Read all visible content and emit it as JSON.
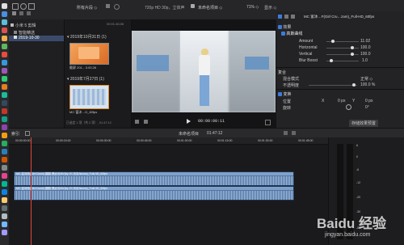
{
  "toolbar": {
    "library_filter": "所有片段 ◇",
    "viewer_format": "720p HD 30p，立体声",
    "project_name": "未命名项目 ◇",
    "zoom": "71% ◇",
    "view_menu": "显示 ◇",
    "inspector_clip": "MC 富沐…F(Girl Cru…zam)_Full-HD_60fps"
  },
  "sidebar": {
    "items": [
      {
        "label": "小米 5 剪辑"
      },
      {
        "label": "智能精选"
      },
      {
        "label": "2019-10-30"
      }
    ]
  },
  "browser": {
    "groups": [
      {
        "date": "2019年10月31日",
        "count": "(1)",
        "clip_label": "截屏 201…3.00.26"
      },
      {
        "date": "2019年7月27日",
        "count": "(1)",
        "clip_label": "MC 富沐…D_60fps"
      }
    ],
    "duration_top": "00:01:46:06",
    "status": "已选定 1 项（共 2 项）, 01:47:12"
  },
  "viewer": {
    "timecode": "00:00:00:11"
  },
  "inspector": {
    "sections": {
      "effects": "效果",
      "shape_mask": "高斯曲线",
      "amount_label": "Amount",
      "amount_value": "11.02",
      "horizontal_label": "Horizontal",
      "horizontal_value": "100.0",
      "vertical_label": "Vertical",
      "vertical_value": "100.0",
      "blur_boost_label": "Blur Boost",
      "blur_boost_value": "1.0",
      "composite": "复合",
      "blend_label": "混合模式",
      "blend_value": "正常 ◇",
      "opacity_label": "不透明度",
      "opacity_value": "100.0 %",
      "transform": "变换",
      "position_label": "位置",
      "pos_x_label": "X",
      "pos_x_value": "0 px",
      "pos_y_label": "Y",
      "pos_y_value": "0 px",
      "rotation_label": "旋转",
      "rotation_value": "0°",
      "save_effects": "存储效果预置"
    }
  },
  "timeline_header": {
    "index_label": "索引",
    "project": "未命名项目",
    "duration": "01:47:12"
  },
  "timeline": {
    "ruler": [
      "00:00:00:00",
      "00:00:15:00",
      "00:00:30:00",
      "00:00:45:00",
      "00:01:00:00",
      "00:01:15:00",
      "00:01:30:00",
      "00:01:45:00"
    ],
    "clips": [
      {
        "label": "MC 富沐然(Girl Crush) 翻跳 黑纱长MV(by JS 乐队Neuxs)_Full-HD_60fps"
      },
      {
        "label": "MC 富沐然(Girl Crush) 翻跳 黑纱长MV(by JS 乐队Neuxs)_Full-HD_60fps"
      }
    ]
  },
  "meters": {
    "scale": [
      "6",
      "0",
      "-6",
      "-12",
      "-20",
      "-30",
      "-50"
    ]
  },
  "watermark": {
    "brand": "Baidu 经验",
    "url": "jingyan.baidu.com"
  },
  "colors": {
    "accent": "#3d7bd9",
    "clip": "#5d7fa6",
    "playhead": "#e0473a"
  }
}
